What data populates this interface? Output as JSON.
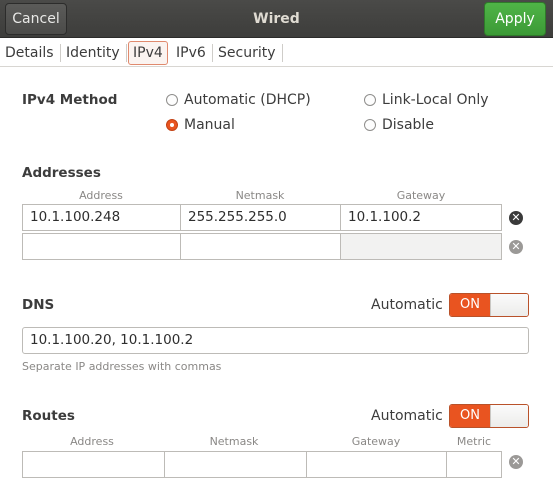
{
  "header": {
    "cancel_label": "Cancel",
    "title": "Wired",
    "apply_label": "Apply"
  },
  "tabs": [
    {
      "label": "Details"
    },
    {
      "label": "Identity"
    },
    {
      "label": "IPv4",
      "active": true
    },
    {
      "label": "IPv6"
    },
    {
      "label": "Security"
    }
  ],
  "ipv4_method": {
    "label": "IPv4 Method",
    "options": [
      {
        "label": "Automatic (DHCP)",
        "selected": false
      },
      {
        "label": "Link-Local Only",
        "selected": false
      },
      {
        "label": "Manual",
        "selected": true
      },
      {
        "label": "Disable",
        "selected": false
      }
    ]
  },
  "addresses": {
    "label": "Addresses",
    "columns": [
      "Address",
      "Netmask",
      "Gateway"
    ],
    "rows": [
      {
        "address": "10.1.100.248",
        "netmask": "255.255.255.0",
        "gateway": "10.1.100.2"
      },
      {
        "address": "",
        "netmask": "",
        "gateway": ""
      }
    ]
  },
  "dns": {
    "label": "DNS",
    "automatic_label": "Automatic",
    "switch_state": "ON",
    "value": "10.1.100.20, 10.1.100.2",
    "hint": "Separate IP addresses with commas"
  },
  "routes": {
    "label": "Routes",
    "automatic_label": "Automatic",
    "switch_state": "ON",
    "columns": [
      "Address",
      "Netmask",
      "Gateway",
      "Metric"
    ]
  },
  "colors": {
    "accent": "#e95420",
    "apply_green": "#45a83f",
    "header_bg": "#454543"
  }
}
